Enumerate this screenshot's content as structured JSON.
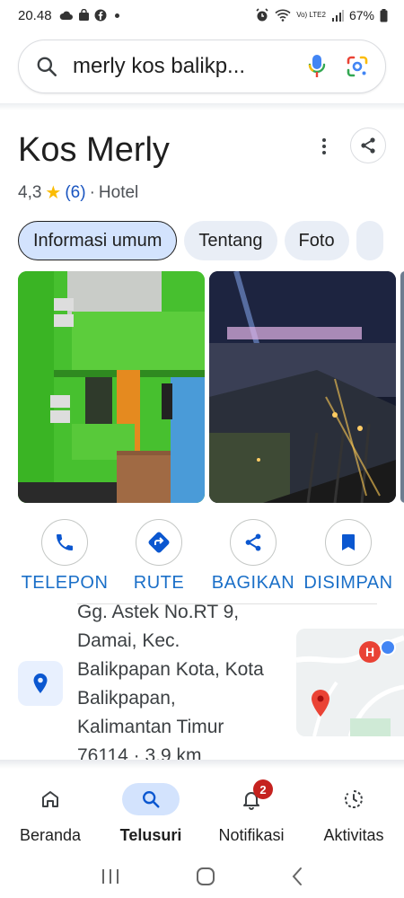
{
  "status_bar": {
    "time": "20.48",
    "battery": "67%",
    "network": "Vo) LTE2"
  },
  "search": {
    "query": "merly kos balikp..."
  },
  "place": {
    "name": "Kos Merly",
    "rating": "4,3",
    "review_count": "(6)",
    "separator": "·",
    "category": "Hotel"
  },
  "chips": [
    "Informasi umum",
    "Tentang",
    "Foto"
  ],
  "actions": {
    "call": "TELEPON",
    "route": "RUTE",
    "share": "BAGIKAN",
    "save": "DISIMPAN"
  },
  "address": {
    "lines": [
      "Gg. Astek No.RT 9,",
      "Damai, Kec.",
      "Balikpapan Kota, Kota",
      "Balikpapan,",
      "Kalimantan Timur",
      "76114 · 3,9 km"
    ]
  },
  "map_pin_letter": "H",
  "bottom_nav": {
    "home": "Beranda",
    "search": "Telusuri",
    "notifications": "Notifikasi",
    "notification_count": "2",
    "activity": "Aktivitas"
  },
  "colors": {
    "accent": "#1a6fc8",
    "chip_bg": "#e9eef6",
    "chip_active_bg": "#d3e3fd",
    "badge": "#c5221f"
  }
}
